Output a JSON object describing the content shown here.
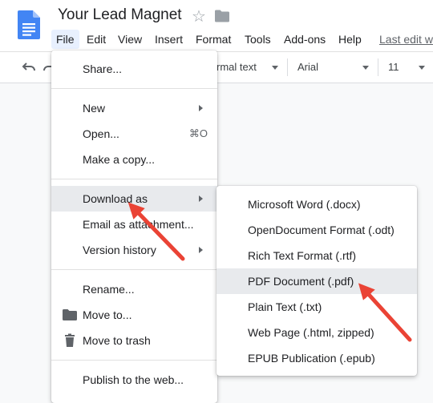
{
  "document": {
    "title": "Your Lead Magnet"
  },
  "icons": {
    "star": "☆"
  },
  "menubar": {
    "items": [
      "File",
      "Edit",
      "View",
      "Insert",
      "Format",
      "Tools",
      "Add-ons",
      "Help"
    ],
    "last_edit": "Last edit w"
  },
  "toolbar": {
    "style_value": "rmal text",
    "font_value": "Arial",
    "size_value": "11"
  },
  "file_menu": {
    "share": "Share...",
    "new": "New",
    "open": "Open...",
    "open_shortcut": "⌘O",
    "make_copy": "Make a copy...",
    "download_as": "Download as",
    "email_attachment": "Email as attachment...",
    "version_history": "Version history",
    "rename": "Rename...",
    "move_to": "Move to...",
    "move_to_trash": "Move to trash",
    "publish": "Publish to the web..."
  },
  "download_submenu": {
    "items": [
      "Microsoft Word (.docx)",
      "OpenDocument Format (.odt)",
      "Rich Text Format (.rtf)",
      "PDF Document (.pdf)",
      "Plain Text (.txt)",
      "Web Page (.html, zipped)",
      "EPUB Publication (.epub)"
    ],
    "highlighted": "PDF Document (.pdf)"
  },
  "colors": {
    "docs_blue": "#4285f4",
    "annotation_red": "#ea4335",
    "menu_highlight": "#e8eaed",
    "active_menu": "#e8f0fe"
  }
}
